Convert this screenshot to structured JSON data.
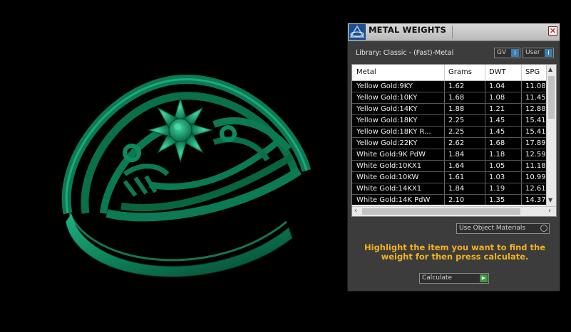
{
  "viewport": {
    "subject": "ring-model"
  },
  "panel": {
    "title": "METAL WEIGHTS",
    "close_glyph": "✕",
    "library_label": "Library: Classic - (Fast)-Metal",
    "toggles": {
      "gv_label": "GV",
      "user_label": "User",
      "indicator": "I"
    },
    "table": {
      "columns": [
        "Metal",
        "Grams",
        "DWT",
        "SPG"
      ],
      "rows": [
        [
          "Yellow Gold:9KY",
          "1.62",
          "1.04",
          "11.08"
        ],
        [
          "Yellow Gold:10KY",
          "1.68",
          "1.08",
          "11.45"
        ],
        [
          "Yellow Gold:14KY",
          "1.88",
          "1.21",
          "12.88"
        ],
        [
          "Yellow Gold:18KY",
          "2.25",
          "1.45",
          "15.41"
        ],
        [
          "Yellow Gold:18KY R...",
          "2.25",
          "1.45",
          "15.41"
        ],
        [
          "Yellow Gold:22KY",
          "2.62",
          "1.68",
          "17.89"
        ],
        [
          "White Gold:9K PdW",
          "1.84",
          "1.18",
          "12.59"
        ],
        [
          "White Gold:10KX1",
          "1.64",
          "1.05",
          "11.18"
        ],
        [
          "White Gold:10KW",
          "1.61",
          "1.03",
          "10.99"
        ],
        [
          "White Gold:14KX1",
          "1.84",
          "1.19",
          "12.61"
        ],
        [
          "White Gold:14K PdW",
          "2.10",
          "1.35",
          "14.37"
        ]
      ]
    },
    "use_object_materials_label": "Use Object Materials",
    "instruction": "Highlight the item you want to find the weight for then press calculate.",
    "calculate_label": "Calculate",
    "colors": {
      "accent": "#f2b21c",
      "ring": "#0a7a55",
      "go": "#3c9b3c"
    }
  }
}
